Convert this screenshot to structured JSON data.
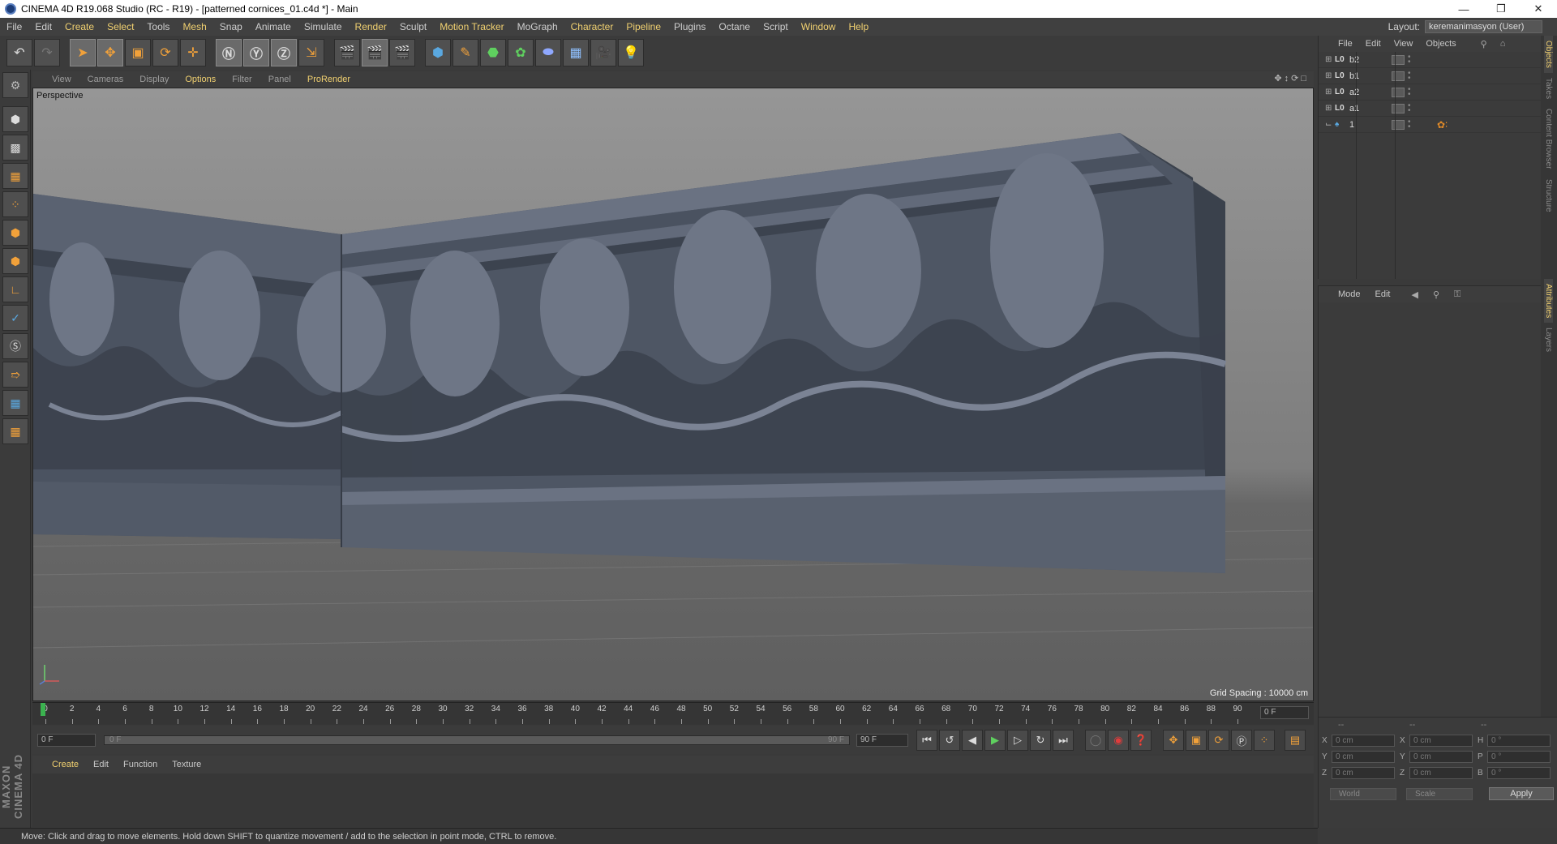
{
  "window": {
    "title": "CINEMA 4D R19.068 Studio (RC - R19) - [patterned cornices_01.c4d *] - Main"
  },
  "menu": [
    "File",
    "Edit",
    "Create",
    "Select",
    "Tools",
    "Mesh",
    "Snap",
    "Animate",
    "Simulate",
    "Render",
    "Sculpt",
    "Motion Tracker",
    "MoGraph",
    "Character",
    "Pipeline",
    "Plugins",
    "Octane",
    "Script",
    "Window",
    "Help"
  ],
  "layout": {
    "label": "Layout:",
    "value": "keremanimasyon (User)"
  },
  "viewport": {
    "menu": [
      "View",
      "Cameras",
      "Display",
      "Options",
      "Filter",
      "Panel",
      "ProRender"
    ],
    "camera_label": "Perspective",
    "grid_spacing": "Grid Spacing : 10000 cm"
  },
  "timeline": {
    "ticks": [
      "0",
      "2",
      "4",
      "6",
      "8",
      "10",
      "12",
      "14",
      "16",
      "18",
      "20",
      "22",
      "24",
      "26",
      "28",
      "30",
      "32",
      "34",
      "36",
      "38",
      "40",
      "42",
      "44",
      "46",
      "48",
      "50",
      "52",
      "54",
      "56",
      "58",
      "60",
      "62",
      "64",
      "66",
      "68",
      "70",
      "72",
      "74",
      "76",
      "78",
      "80",
      "82",
      "84",
      "86",
      "88",
      "90"
    ],
    "current_frame": "0 F"
  },
  "transport": {
    "start": "0 F",
    "slider_start": "0 F",
    "slider_end": "90 F",
    "end": "90 F"
  },
  "material": {
    "menu": [
      "Create",
      "Edit",
      "Function",
      "Texture"
    ]
  },
  "status": "Move: Click and drag to move elements. Hold down SHIFT to quantize movement / add to the selection in point mode, CTRL to remove.",
  "objects": {
    "menu": [
      "File",
      "Edit",
      "View",
      "Objects"
    ],
    "rows": [
      {
        "name": "b2",
        "icon": "lo"
      },
      {
        "name": "b1",
        "icon": "lo"
      },
      {
        "name": "a2",
        "icon": "lo"
      },
      {
        "name": "a1",
        "icon": "lo"
      },
      {
        "name": "1",
        "icon": "figure"
      }
    ]
  },
  "side_tabs_top": [
    "Objects",
    "Takes",
    "Content Browser",
    "Structure"
  ],
  "side_tabs_bottom": [
    "Attributes",
    "Layers"
  ],
  "attributes": {
    "menu": [
      "Mode",
      "Edit"
    ]
  },
  "coords": {
    "headers": [
      "--",
      "--",
      "--"
    ],
    "rows": [
      {
        "a1": "X",
        "v1": "0 cm",
        "a2": "X",
        "v2": "0 cm",
        "a3": "H",
        "v3": "0 °"
      },
      {
        "a1": "Y",
        "v1": "0 cm",
        "a2": "Y",
        "v2": "0 cm",
        "a3": "P",
        "v3": "0 °"
      },
      {
        "a1": "Z",
        "v1": "0 cm",
        "a2": "Z",
        "v2": "0 cm",
        "a3": "B",
        "v3": "0 °"
      }
    ],
    "space": "World",
    "mode": "Scale",
    "apply": "Apply"
  },
  "maxon": "MAXON CINEMA 4D",
  "colors": {
    "accent": "#f0d070",
    "timeline_cursor": "#3bb24f",
    "model": "#4a5362"
  }
}
